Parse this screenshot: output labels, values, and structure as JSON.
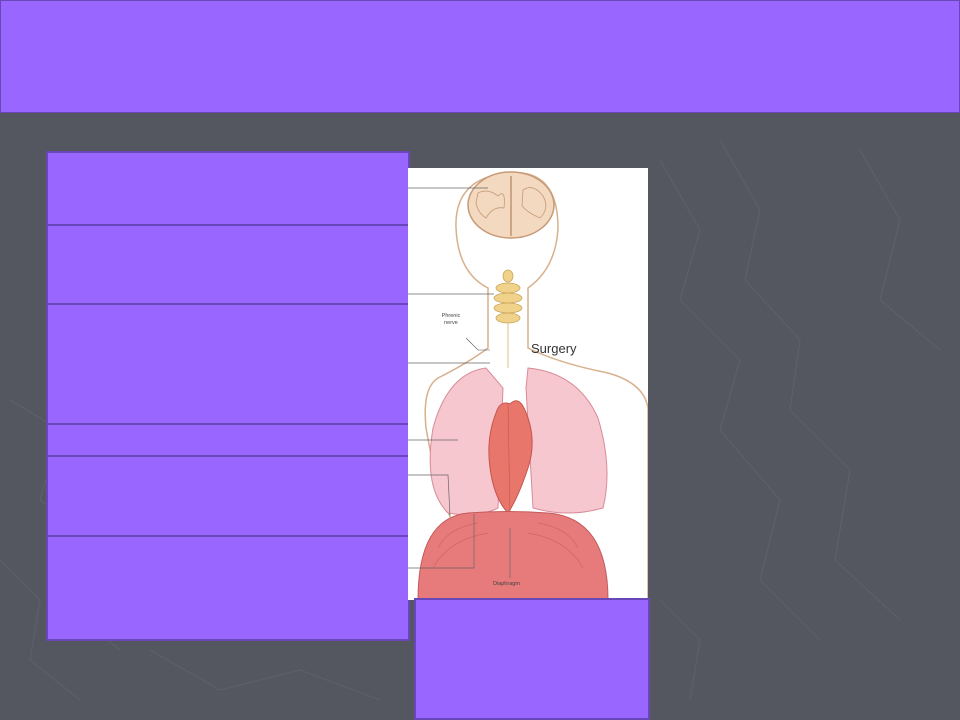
{
  "title_bar": {
    "color": "#9966ff"
  },
  "figure": {
    "labels": {
      "phrenic_nerve": "Phrenic nerve",
      "surgery": "Surgery",
      "diaphragm": "Diaphragm"
    }
  },
  "colors": {
    "accent": "#9966ff",
    "background": "#545660"
  }
}
